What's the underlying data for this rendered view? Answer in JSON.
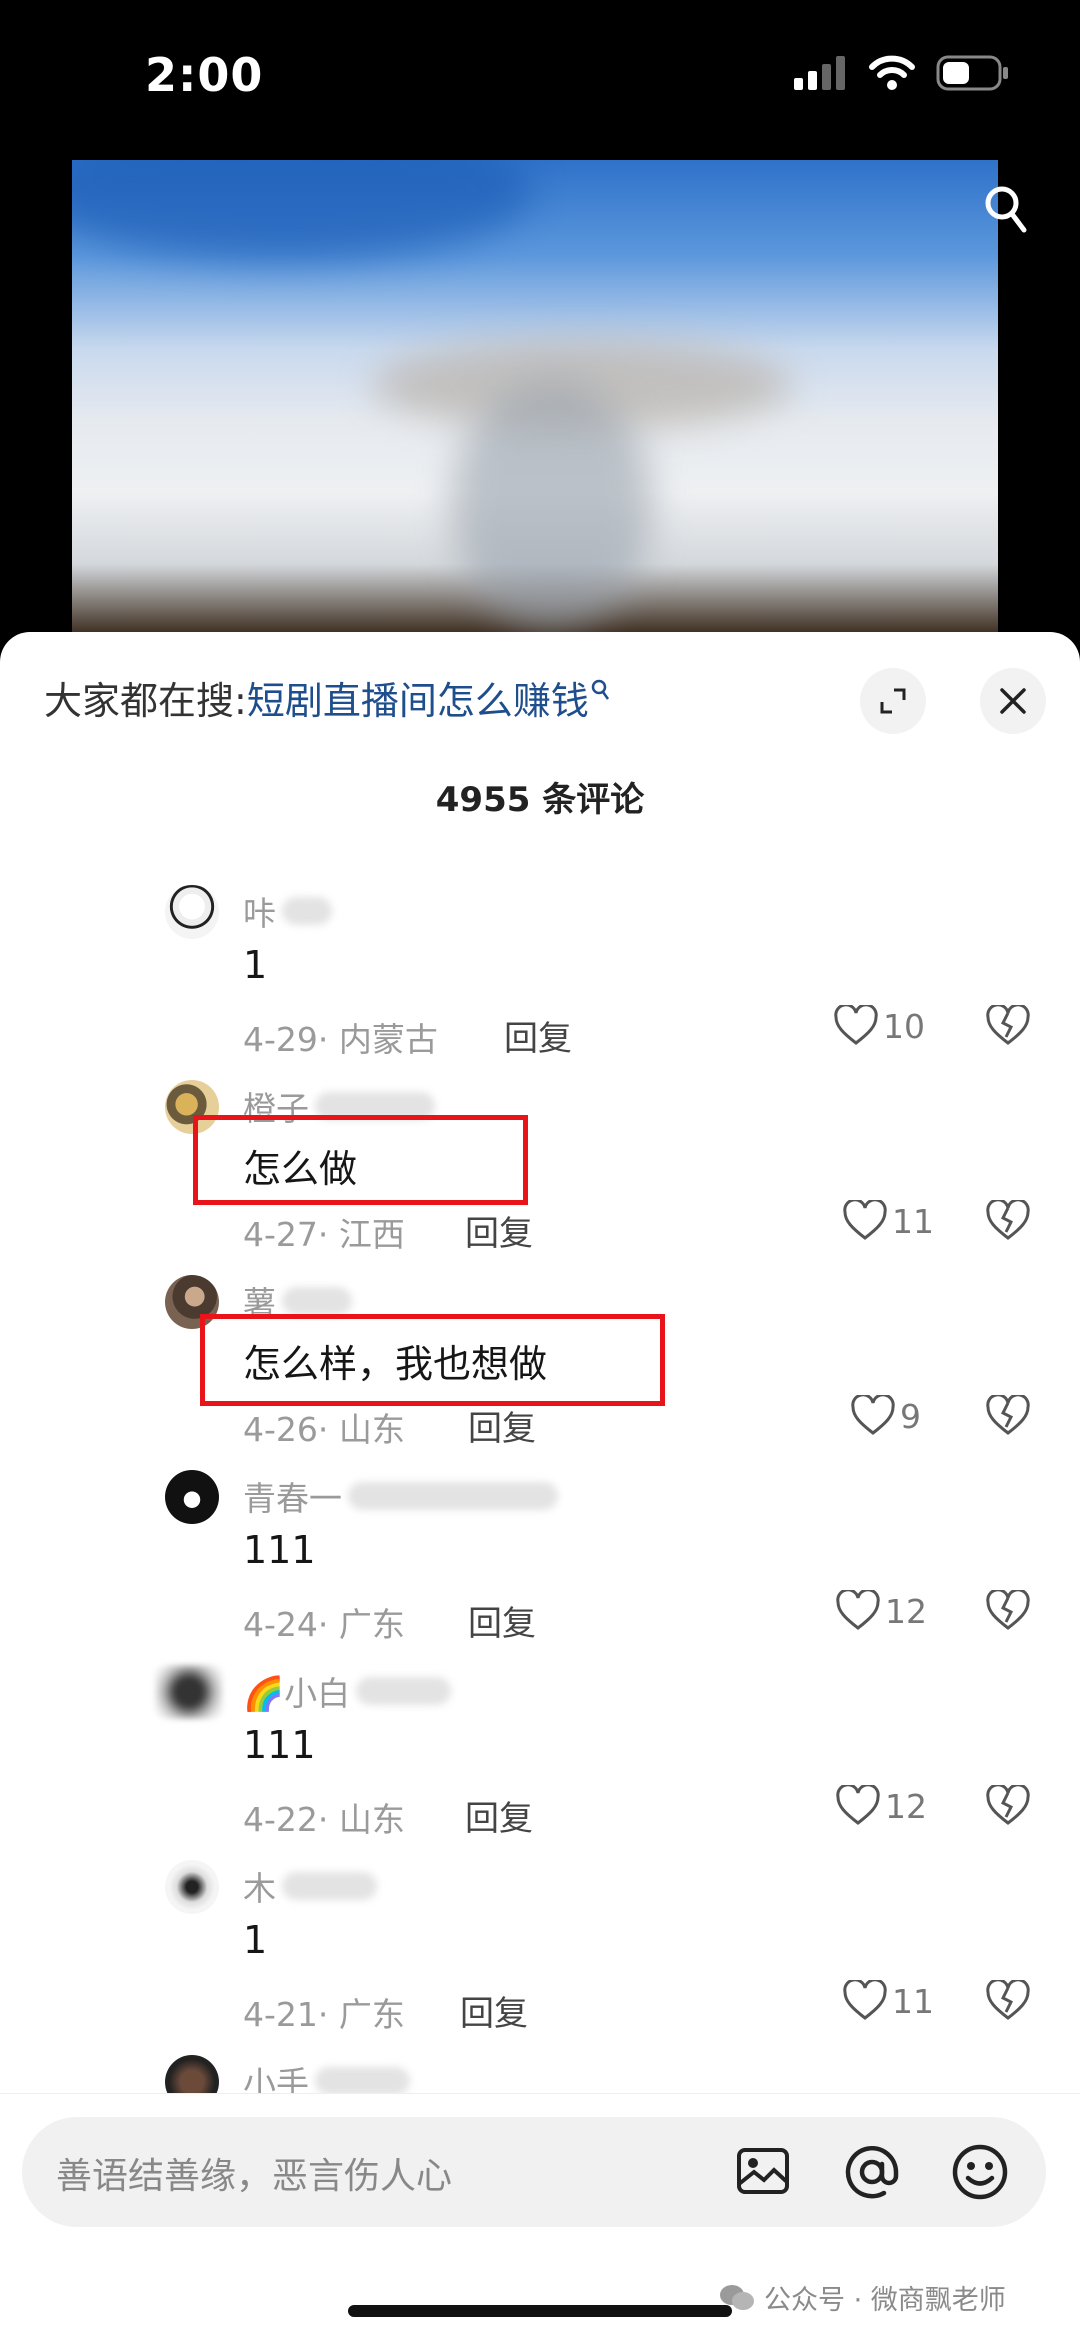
{
  "status": {
    "time": "2:00"
  },
  "sheet": {
    "search_prefix": "大家都在搜:",
    "search_link": "短剧直播间怎么赚钱",
    "comment_count": "4955 条评论"
  },
  "comments": [
    {
      "name": "咔",
      "text": "1",
      "date": "4-29",
      "location": "内蒙古",
      "reply": "回复",
      "likes": "10"
    },
    {
      "name": "橙子",
      "text": "怎么做",
      "date": "4-27",
      "location": "江西",
      "reply": "回复",
      "likes": "11"
    },
    {
      "name": "薯",
      "text": "怎么样，我也想做",
      "date": "4-26",
      "location": "山东",
      "reply": "回复",
      "likes": "9"
    },
    {
      "name": "青春一",
      "text": "111",
      "date": "4-24",
      "location": "广东",
      "reply": "回复",
      "likes": "12"
    },
    {
      "name": "🌈小白",
      "text": "111",
      "date": "4-22",
      "location": "山东",
      "reply": "回复",
      "likes": "12"
    },
    {
      "name": "木",
      "text": "1",
      "date": "4-21",
      "location": "广东",
      "reply": "回复",
      "likes": "11"
    },
    {
      "name": "小手"
    }
  ],
  "input": {
    "placeholder": "善语结善缘，恶言伤人心"
  },
  "watermark": "公众号 · 微商飘老师",
  "icons": [
    "search-icon",
    "expand-icon",
    "close-icon",
    "heart-icon",
    "broken-heart-icon",
    "image-icon",
    "at-icon",
    "emoji-icon",
    "wechat-icon"
  ]
}
